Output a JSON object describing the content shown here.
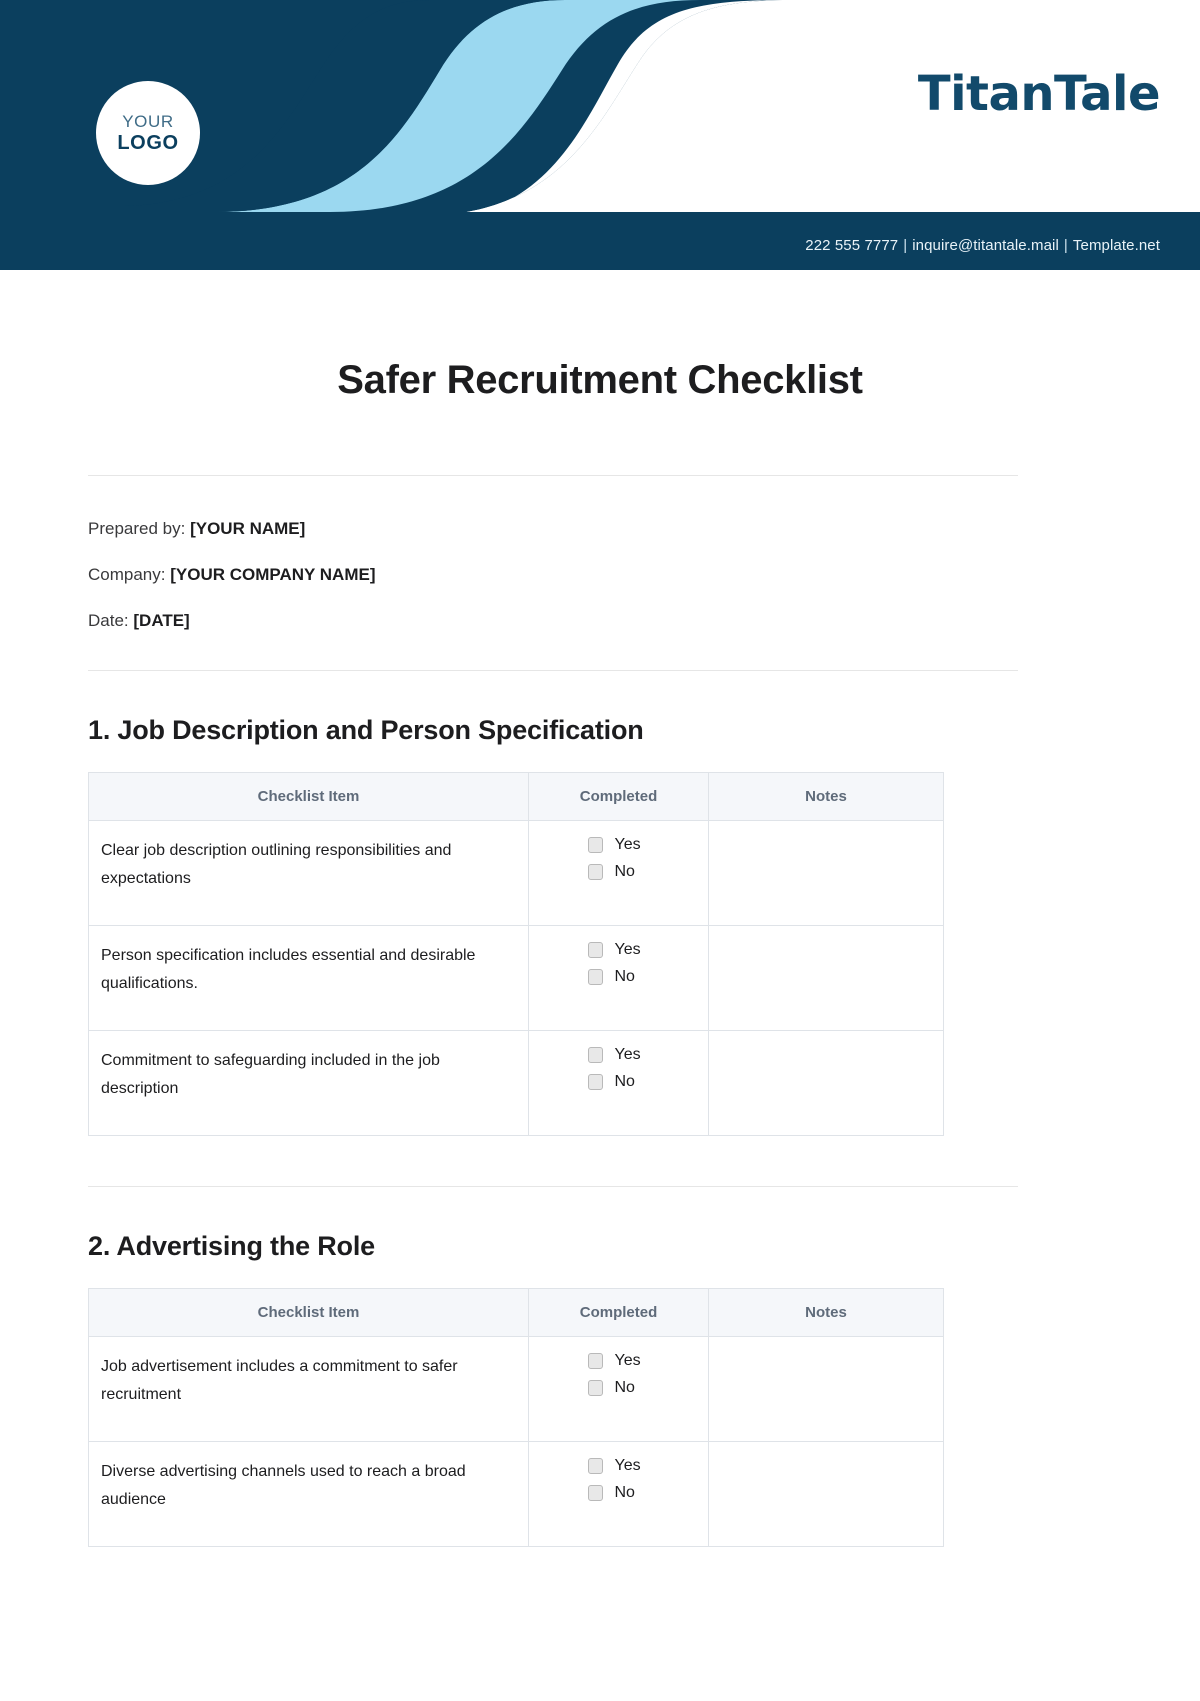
{
  "header": {
    "logo_line1": "YOUR",
    "logo_line2": "LOGO",
    "brand": "TitanTale",
    "contact": {
      "phone": "222 555 7777",
      "email": "inquire@titantale.mail",
      "website": "Template.net",
      "separator": "|"
    },
    "colors": {
      "navy": "#0b3f5e",
      "light_blue": "#9bd8f0",
      "brand_text": "#124a6b"
    }
  },
  "document": {
    "title": "Safer Recruitment Checklist",
    "meta": [
      {
        "label": "Prepared by:",
        "value": "[YOUR NAME]"
      },
      {
        "label": "Company:",
        "value": "[YOUR COMPANY NAME]"
      },
      {
        "label": "Date:",
        "value": "[DATE]"
      }
    ]
  },
  "table_headers": {
    "item": "Checklist Item",
    "completed": "Completed",
    "notes": "Notes"
  },
  "options": {
    "yes": "Yes",
    "no": "No"
  },
  "sections": [
    {
      "heading": "1. Job Description and Person Specification",
      "rows": [
        {
          "item": "Clear job description outlining responsibilities and expectations",
          "notes": ""
        },
        {
          "item": "Person specification includes essential and desirable qualifications.",
          "notes": ""
        },
        {
          "item": "Commitment to safeguarding included in the job description",
          "notes": ""
        }
      ]
    },
    {
      "heading": "2. Advertising the Role",
      "rows": [
        {
          "item": "Job advertisement includes a commitment to safer recruitment",
          "notes": ""
        },
        {
          "item": "Diverse advertising channels used to reach a broad audience",
          "notes": ""
        }
      ]
    }
  ]
}
